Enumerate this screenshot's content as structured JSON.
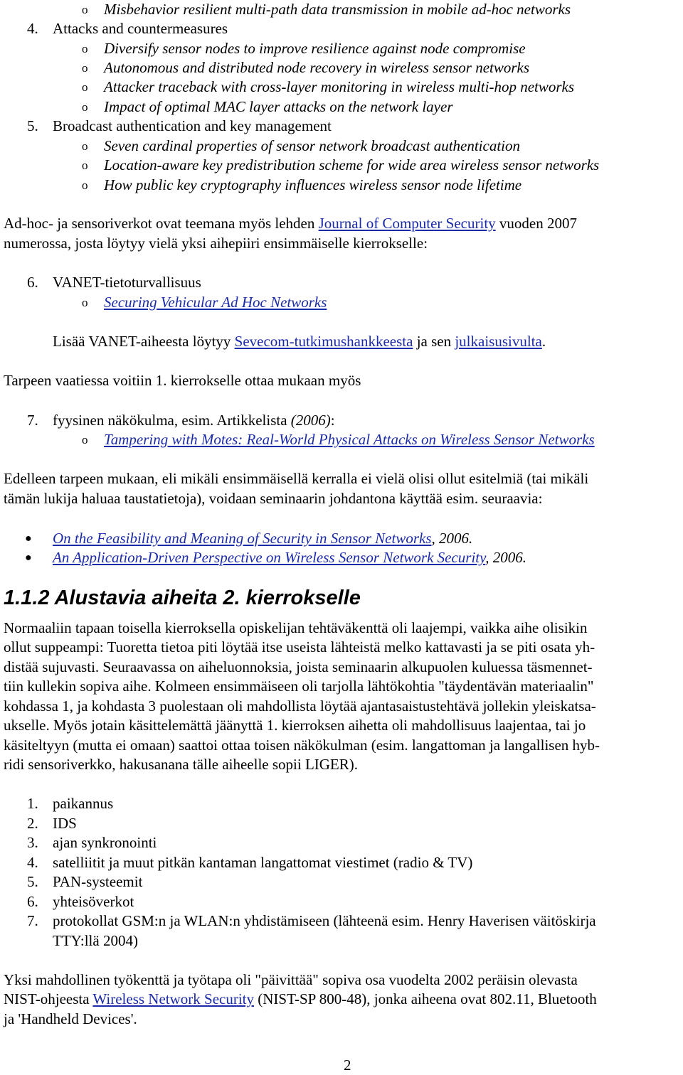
{
  "top_sublist": [
    "Misbehavior resilient multi-path data transmission in mobile ad-hoc networks"
  ],
  "section4": {
    "num": "4.",
    "title": "Attacks and countermeasures",
    "items": [
      "Diversify sensor nodes to improve resilience against node compromise",
      "Autonomous and distributed node recovery in wireless sensor networks",
      "Attacker traceback with cross-layer monitoring in wireless multi-hop networks",
      "Impact of optimal MAC layer attacks on the network layer"
    ]
  },
  "section5": {
    "num": "5.",
    "title": "Broadcast authentication and key management",
    "items": [
      "Seven cardinal properties of sensor network broadcast authentication",
      "Location-aware key predistribution scheme for wide area wireless sensor networks",
      "How public key cryptography influences wireless sensor node lifetime"
    ]
  },
  "adhoc_para": {
    "before": "Ad-hoc- ja sensoriverkot ovat teemana myös lehden ",
    "link": "Journal of Computer Security",
    "after": " vuoden 2007",
    "line2": "numerossa, josta löytyy vielä yksi aihepiiri ensimmäiselle kierrokselle:"
  },
  "section6": {
    "num": "6.",
    "title": "VANET-tietoturvallisuus",
    "link_item": "Securing Vehicular Ad Hoc Networks",
    "more": {
      "before": "Lisää VANET-aiheesta löytyy ",
      "link1": "Sevecom-tutkimushankkeesta",
      "middle": " ja sen ",
      "link2": "julkaisusivulta",
      "after": "."
    }
  },
  "tarpeen": "Tarpeen vaatiessa voitiin 1. kierrokselle ottaa mukaan myös",
  "section7": {
    "num": "7.",
    "title": "fyysinen näkökulma, esim. Artikkelista ",
    "year": "(2006)",
    "colon": ":",
    "link_item": "Tampering with Motes: Real-World Physical Attacks on Wireless Sensor Networks"
  },
  "edelleen": {
    "line1": "Edelleen tarpeen mukaan, eli mikäli ensimmäisellä kerralla ei vielä olisi ollut esitelmiä (tai mikäli",
    "line2": "tämän lukija haluaa taustatietoja), voidaan seminaarin johdantona käyttää esim. seuraavia:"
  },
  "refs": [
    {
      "link": "On the Feasibility and Meaning of Security in Sensor Networks",
      "year": ", 2006."
    },
    {
      "link": "An Application-Driven Perspective on Wireless Sensor Network Security",
      "year": ", 2006."
    }
  ],
  "heading": "1.1.2  Alustavia aiheita 2. kierrokselle",
  "normaaliin": [
    "Normaaliin tapaan toisella kierroksella opiskelijan tehtäväkenttä oli laajempi, vaikka aihe olisikin",
    "ollut suppeampi: Tuoretta tietoa piti löytää itse useista lähteistä melko kattavasti ja se piti osata yh-",
    "distää sujuvasti. Seuraavassa on aiheluonnoksia, joista seminaarin alkupuolen kuluessa täsmennet-",
    "tiin kullekin sopiva aihe. Kolmeen ensimmäiseen oli tarjolla lähtökohtia \"täydentävän materiaalin\"",
    "kohdassa 1, ja kohdasta 3 puolestaan oli mahdollista löytää ajantasaistustehtävä jollekin yleiskatsa-",
    "ukselle. Myös jotain käsittelemättä jäänyttä 1. kierroksen aihetta oli mahdollisuus laajentaa, tai jo",
    "käsiteltyyn (mutta ei omaan) saattoi ottaa toisen näkökulman (esim. langattoman ja langallisen hyb-",
    "ridi sensoriverkko, hakusanana tälle aiheelle sopii  LIGER)."
  ],
  "topics": [
    {
      "num": "1.",
      "text": "paikannus"
    },
    {
      "num": "2.",
      "text": "IDS"
    },
    {
      "num": "3.",
      "text": "ajan synkronointi"
    },
    {
      "num": "4.",
      "text": "satelliitit ja muut pitkän kantaman langattomat viestimet (radio & TV)"
    },
    {
      "num": "5.",
      "text": "PAN-systeemit"
    },
    {
      "num": "6.",
      "text": "yhteisöverkot"
    },
    {
      "num": "7.",
      "text": "protokollat GSM:n ja WLAN:n yhdistämiseen (lähteenä esim. Henry Haverisen väitöskirja",
      "text2": "TTY:llä 2004)"
    }
  ],
  "yksi": {
    "line1": "Yksi mahdollinen työkenttä ja työtapa oli \"päivittää\" sopiva osa vuodelta 2002 peräisin olevasta",
    "before": "NIST-ohjeesta ",
    "link": "Wireless Network Security",
    "after": " (NIST-SP 800-48), jonka aiheena ovat 802.11, Bluetooth",
    "line3": "ja 'Handheld Devices'."
  },
  "page_number": "2",
  "colors": {
    "link": "#1a2aa8",
    "text": "#000000"
  }
}
